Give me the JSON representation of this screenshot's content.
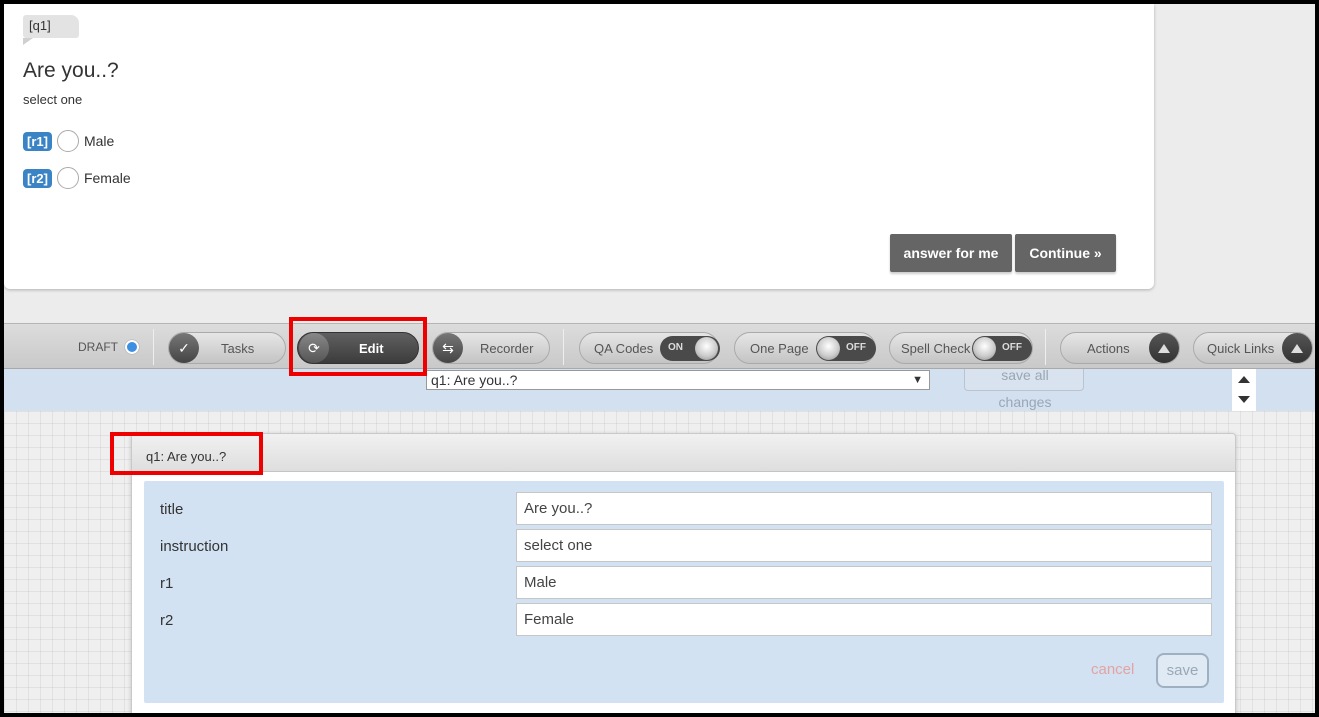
{
  "preview": {
    "question_tag": "[q1]",
    "title": "Are you..?",
    "instruction": "select one",
    "rows": [
      {
        "badge": "[r1]",
        "label": "Male"
      },
      {
        "badge": "[r2]",
        "label": "Female"
      }
    ],
    "answer_for_me_label": "answer for me",
    "continue_label": "Continue »"
  },
  "toolbar": {
    "draft_label": "DRAFT",
    "tasks_label": "Tasks",
    "edit_label": "Edit",
    "recorder_label": "Recorder",
    "qa_codes_label": "QA Codes",
    "qa_codes_state": "ON",
    "one_page_label": "One Page",
    "one_page_state": "OFF",
    "spell_check_label": "Spell Check",
    "spell_check_state": "OFF",
    "actions_label": "Actions",
    "quick_links_label": "Quick Links",
    "accent_color": "#3d8fe2",
    "highlight_color": "#e00000"
  },
  "selector": {
    "selected_question": "q1: Are you..?",
    "save_all_line1": "save all",
    "save_all_line2": "changes"
  },
  "editor": {
    "panel_title": "q1: Are you..?",
    "fields": [
      {
        "label": "title",
        "value": "Are you..?"
      },
      {
        "label": "instruction",
        "value": "select one"
      },
      {
        "label": "r1",
        "value": "Male"
      },
      {
        "label": "r2",
        "value": "Female"
      }
    ],
    "cancel_label": "cancel",
    "save_label": "save"
  }
}
